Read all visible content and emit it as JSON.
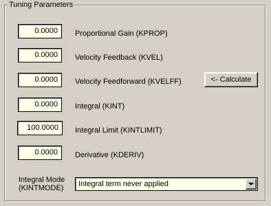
{
  "group": {
    "title": "Tuning Parameters"
  },
  "params": [
    {
      "value": "0.0000",
      "label": "Proportional Gain (KPROP)"
    },
    {
      "value": "0.0000",
      "label": "Velocity Feedback (KVEL)"
    },
    {
      "value": "0.0000",
      "label": "Velocity Feedforward (KVELFF)"
    },
    {
      "value": "0.0000",
      "label": "Integral (KINT)"
    },
    {
      "value": "100.0000",
      "label": "Integral Limit (KINTLIMIT)"
    },
    {
      "value": "0.0000",
      "label": "Derivative (KDERIV)"
    }
  ],
  "calculate_button": {
    "label": "<- Calculate"
  },
  "integral_mode": {
    "label_line1": "Integral Mode",
    "label_line2": "(KINTMODE)",
    "selected": "Integral term never applied"
  }
}
